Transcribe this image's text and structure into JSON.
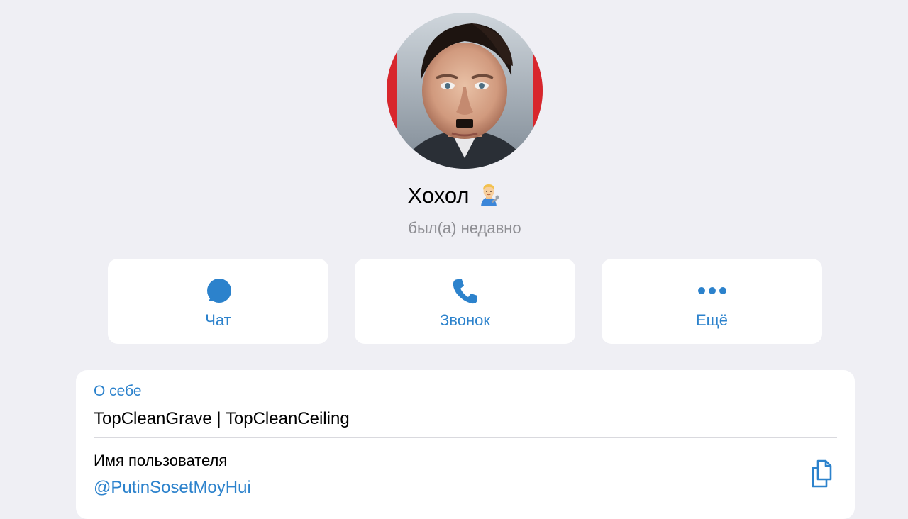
{
  "profile": {
    "name": "Хохол",
    "name_emoji": "man-mechanic-emoji",
    "status": "был(а) недавно"
  },
  "actions": [
    {
      "label": "Чат",
      "icon": "chat-bubble-icon"
    },
    {
      "label": "Звонок",
      "icon": "phone-icon"
    },
    {
      "label": "Ещё",
      "icon": "more-dots-icon"
    }
  ],
  "info": {
    "about_label": "О себе",
    "about_text": "TopCleanGrave | TopCleanCeiling",
    "username_label": "Имя пользователя",
    "username": "@PutinSosetMoyHui",
    "copy_icon": "copy-icon"
  },
  "colors": {
    "background": "#efeff4",
    "card": "#ffffff",
    "accent": "#2c82cc",
    "secondary_text": "#8e8e93"
  }
}
